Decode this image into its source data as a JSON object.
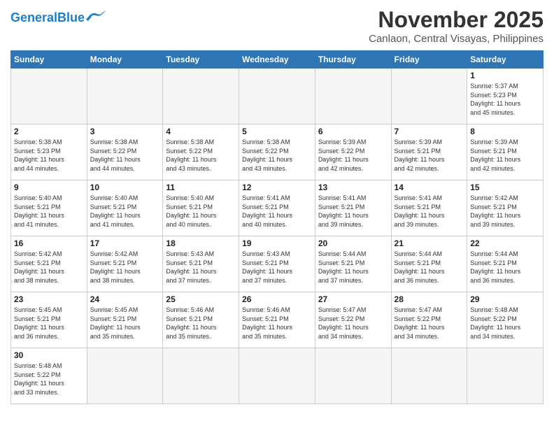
{
  "header": {
    "logo_general": "General",
    "logo_blue": "Blue",
    "month_year": "November 2025",
    "location": "Canlaon, Central Visayas, Philippines"
  },
  "days_of_week": [
    "Sunday",
    "Monday",
    "Tuesday",
    "Wednesday",
    "Thursday",
    "Friday",
    "Saturday"
  ],
  "weeks": [
    [
      {
        "day": null,
        "info": null
      },
      {
        "day": null,
        "info": null
      },
      {
        "day": null,
        "info": null
      },
      {
        "day": null,
        "info": null
      },
      {
        "day": null,
        "info": null
      },
      {
        "day": null,
        "info": null
      },
      {
        "day": "1",
        "info": "Sunrise: 5:37 AM\nSunset: 5:23 PM\nDaylight: 11 hours\nand 45 minutes."
      }
    ],
    [
      {
        "day": "2",
        "info": "Sunrise: 5:38 AM\nSunset: 5:23 PM\nDaylight: 11 hours\nand 44 minutes."
      },
      {
        "day": "3",
        "info": "Sunrise: 5:38 AM\nSunset: 5:22 PM\nDaylight: 11 hours\nand 44 minutes."
      },
      {
        "day": "4",
        "info": "Sunrise: 5:38 AM\nSunset: 5:22 PM\nDaylight: 11 hours\nand 43 minutes."
      },
      {
        "day": "5",
        "info": "Sunrise: 5:38 AM\nSunset: 5:22 PM\nDaylight: 11 hours\nand 43 minutes."
      },
      {
        "day": "6",
        "info": "Sunrise: 5:39 AM\nSunset: 5:22 PM\nDaylight: 11 hours\nand 42 minutes."
      },
      {
        "day": "7",
        "info": "Sunrise: 5:39 AM\nSunset: 5:21 PM\nDaylight: 11 hours\nand 42 minutes."
      },
      {
        "day": "8",
        "info": "Sunrise: 5:39 AM\nSunset: 5:21 PM\nDaylight: 11 hours\nand 42 minutes."
      }
    ],
    [
      {
        "day": "9",
        "info": "Sunrise: 5:40 AM\nSunset: 5:21 PM\nDaylight: 11 hours\nand 41 minutes."
      },
      {
        "day": "10",
        "info": "Sunrise: 5:40 AM\nSunset: 5:21 PM\nDaylight: 11 hours\nand 41 minutes."
      },
      {
        "day": "11",
        "info": "Sunrise: 5:40 AM\nSunset: 5:21 PM\nDaylight: 11 hours\nand 40 minutes."
      },
      {
        "day": "12",
        "info": "Sunrise: 5:41 AM\nSunset: 5:21 PM\nDaylight: 11 hours\nand 40 minutes."
      },
      {
        "day": "13",
        "info": "Sunrise: 5:41 AM\nSunset: 5:21 PM\nDaylight: 11 hours\nand 39 minutes."
      },
      {
        "day": "14",
        "info": "Sunrise: 5:41 AM\nSunset: 5:21 PM\nDaylight: 11 hours\nand 39 minutes."
      },
      {
        "day": "15",
        "info": "Sunrise: 5:42 AM\nSunset: 5:21 PM\nDaylight: 11 hours\nand 39 minutes."
      }
    ],
    [
      {
        "day": "16",
        "info": "Sunrise: 5:42 AM\nSunset: 5:21 PM\nDaylight: 11 hours\nand 38 minutes."
      },
      {
        "day": "17",
        "info": "Sunrise: 5:42 AM\nSunset: 5:21 PM\nDaylight: 11 hours\nand 38 minutes."
      },
      {
        "day": "18",
        "info": "Sunrise: 5:43 AM\nSunset: 5:21 PM\nDaylight: 11 hours\nand 37 minutes."
      },
      {
        "day": "19",
        "info": "Sunrise: 5:43 AM\nSunset: 5:21 PM\nDaylight: 11 hours\nand 37 minutes."
      },
      {
        "day": "20",
        "info": "Sunrise: 5:44 AM\nSunset: 5:21 PM\nDaylight: 11 hours\nand 37 minutes."
      },
      {
        "day": "21",
        "info": "Sunrise: 5:44 AM\nSunset: 5:21 PM\nDaylight: 11 hours\nand 36 minutes."
      },
      {
        "day": "22",
        "info": "Sunrise: 5:44 AM\nSunset: 5:21 PM\nDaylight: 11 hours\nand 36 minutes."
      }
    ],
    [
      {
        "day": "23",
        "info": "Sunrise: 5:45 AM\nSunset: 5:21 PM\nDaylight: 11 hours\nand 36 minutes."
      },
      {
        "day": "24",
        "info": "Sunrise: 5:45 AM\nSunset: 5:21 PM\nDaylight: 11 hours\nand 35 minutes."
      },
      {
        "day": "25",
        "info": "Sunrise: 5:46 AM\nSunset: 5:21 PM\nDaylight: 11 hours\nand 35 minutes."
      },
      {
        "day": "26",
        "info": "Sunrise: 5:46 AM\nSunset: 5:21 PM\nDaylight: 11 hours\nand 35 minutes."
      },
      {
        "day": "27",
        "info": "Sunrise: 5:47 AM\nSunset: 5:22 PM\nDaylight: 11 hours\nand 34 minutes."
      },
      {
        "day": "28",
        "info": "Sunrise: 5:47 AM\nSunset: 5:22 PM\nDaylight: 11 hours\nand 34 minutes."
      },
      {
        "day": "29",
        "info": "Sunrise: 5:48 AM\nSunset: 5:22 PM\nDaylight: 11 hours\nand 34 minutes."
      }
    ],
    [
      {
        "day": "30",
        "info": "Sunrise: 5:48 AM\nSunset: 5:22 PM\nDaylight: 11 hours\nand 33 minutes."
      },
      {
        "day": null,
        "info": null
      },
      {
        "day": null,
        "info": null
      },
      {
        "day": null,
        "info": null
      },
      {
        "day": null,
        "info": null
      },
      {
        "day": null,
        "info": null
      },
      {
        "day": null,
        "info": null
      }
    ]
  ]
}
